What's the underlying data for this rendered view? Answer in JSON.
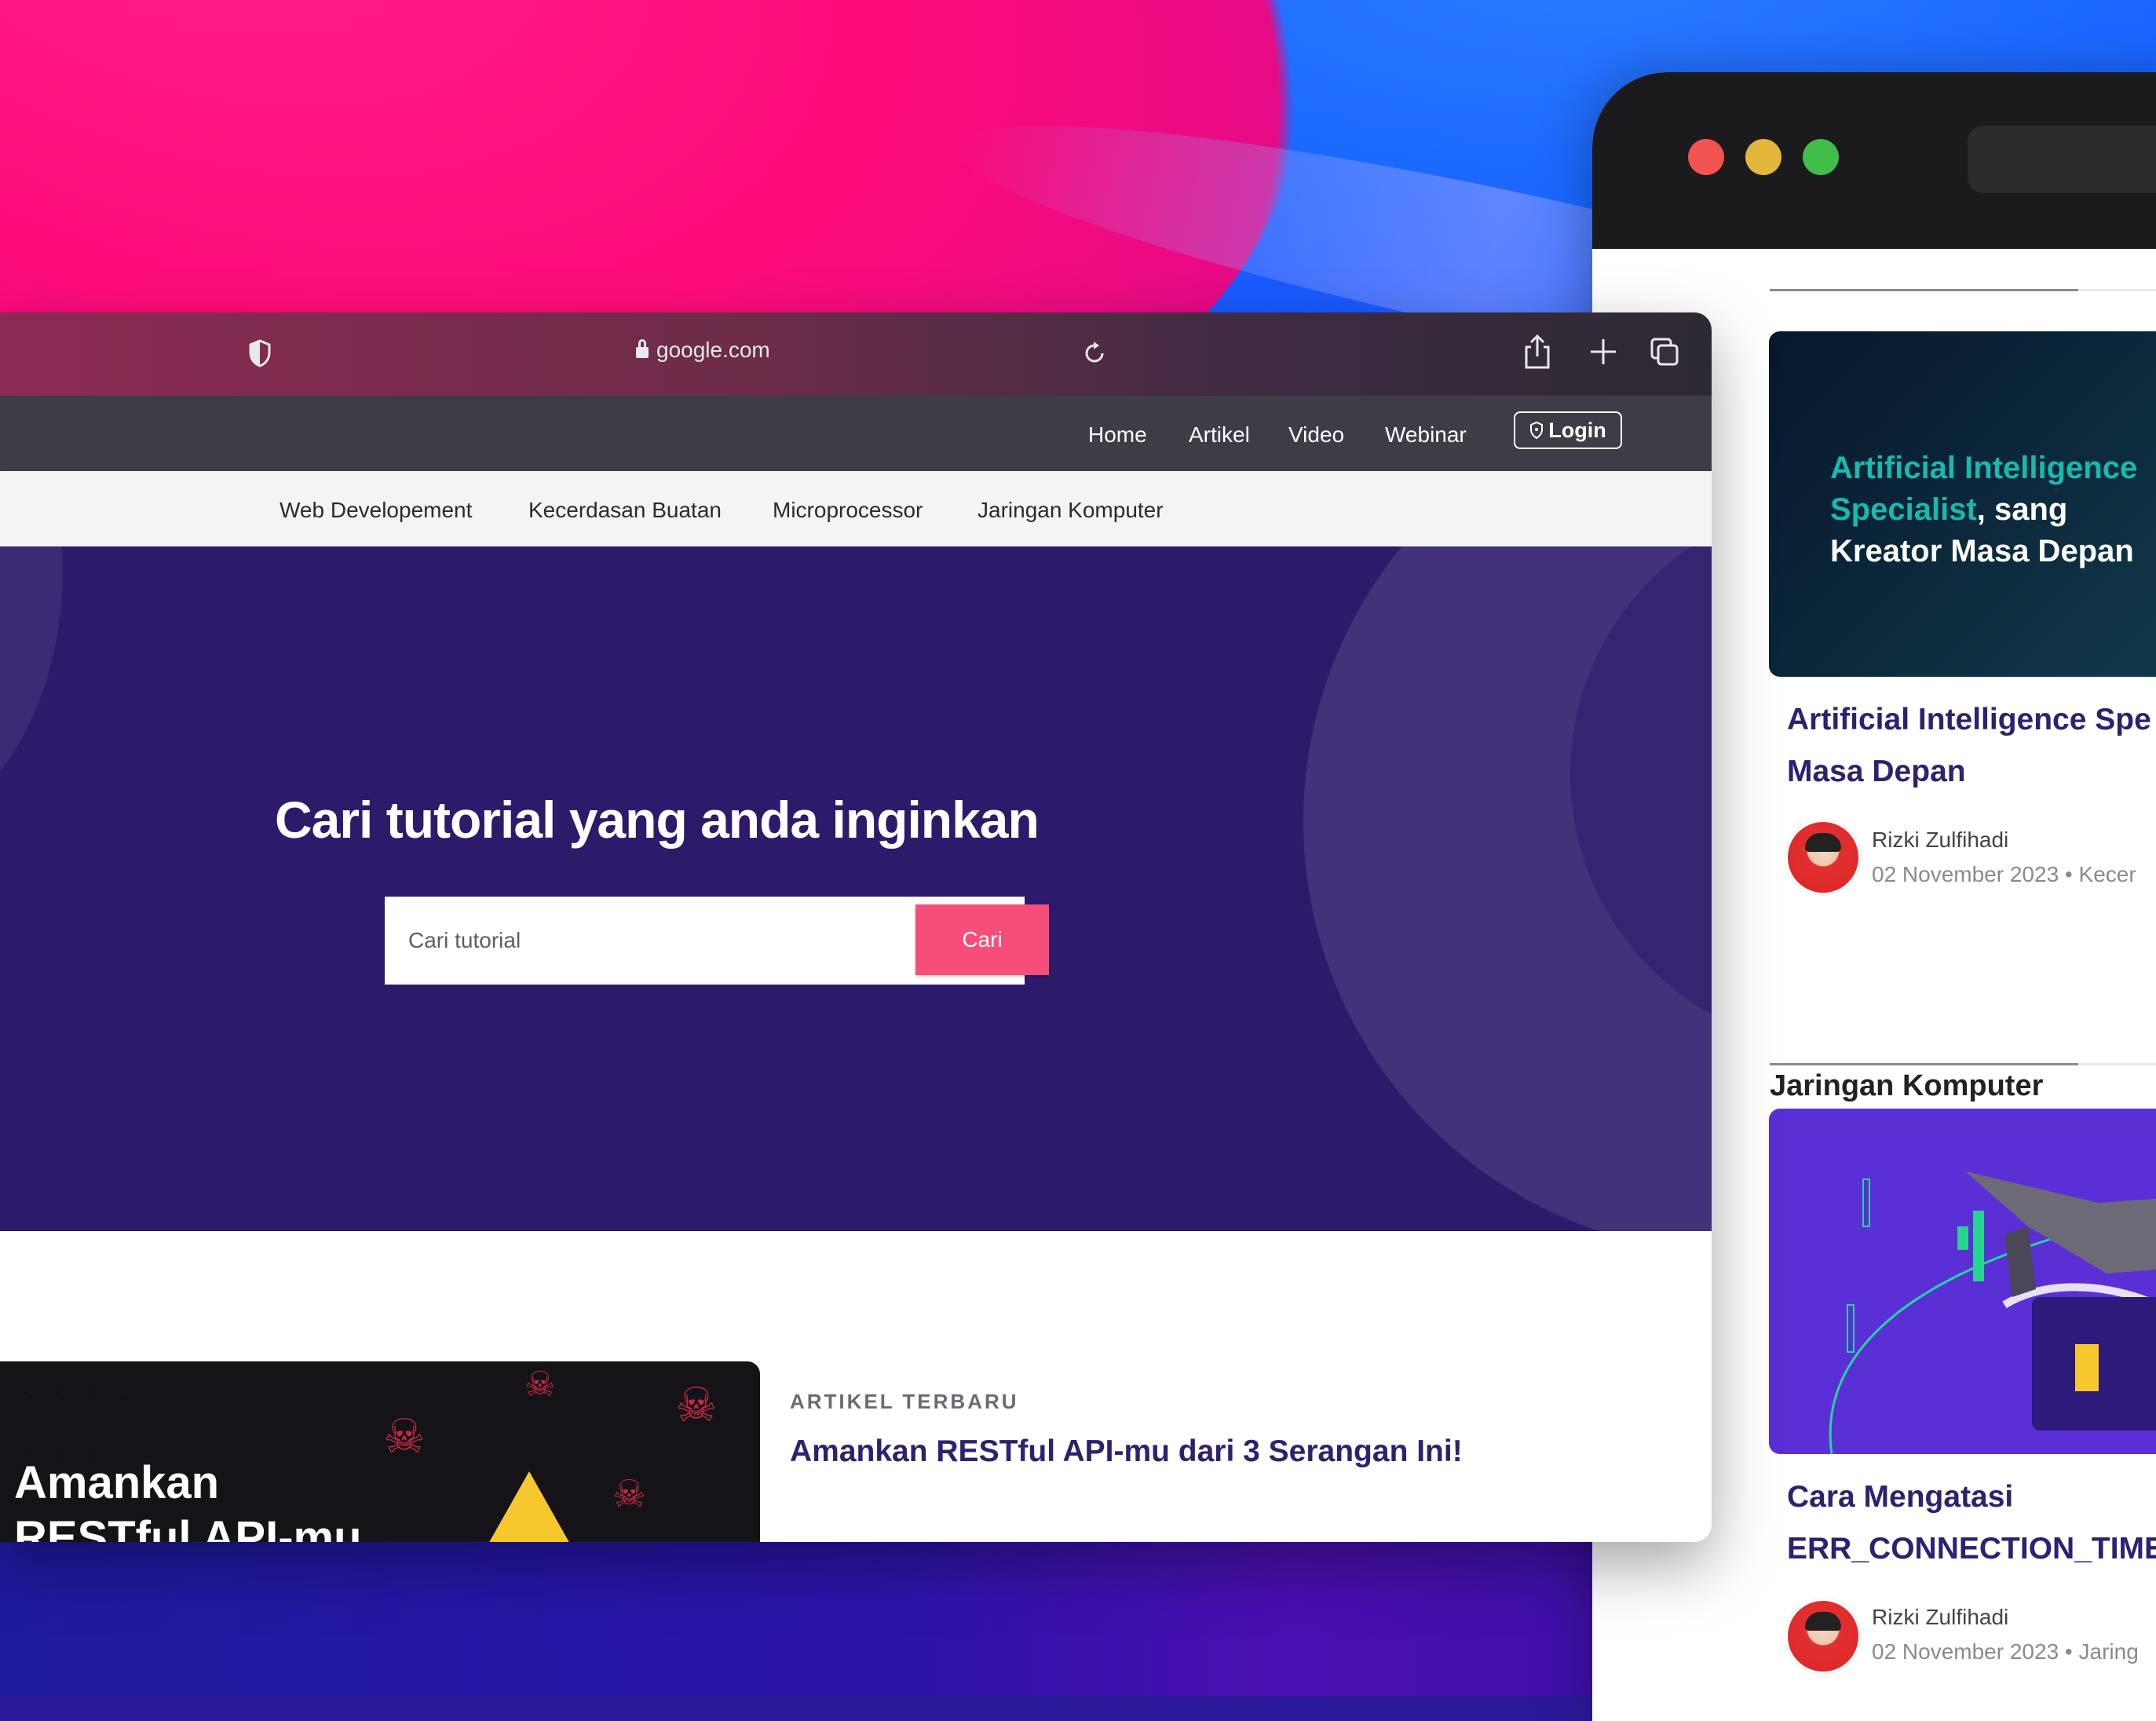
{
  "browser": {
    "url": "google.com"
  },
  "nav": {
    "items": [
      "Home",
      "Artikel",
      "Video",
      "Webinar"
    ],
    "login_label": "Login"
  },
  "categories": [
    "Web Developement",
    "Kecerdasan Buatan",
    "Microprocessor",
    "Jaringan Komputer"
  ],
  "hero": {
    "title": "Cari tutorial yang anda inginkan",
    "search_placeholder": "Cari tutorial",
    "search_button": "Cari"
  },
  "latest": {
    "kicker": "ARTIKEL TERBARU",
    "title": "Amankan RESTful API-mu dari 3 Serangan Ini!",
    "image_text_line1": "Amankan",
    "image_text_line2": "RESTful API-mu"
  },
  "side": {
    "ai_card": {
      "image_accent": "Artificial Intelligence Specialist",
      "image_text_rest": ", sang Kreator Masa Depan",
      "title_line1": "Artificial Intelligence Spe",
      "title_line2": "Masa Depan",
      "author": "Rizki Zulfihadi",
      "meta": "02 November 2023 • Kecer"
    },
    "section_heading": "Jaringan Komputer",
    "net_card": {
      "title_line1": "Cara Mengatasi",
      "title_line2": "ERR_CONNECTION_TIME",
      "author": "Rizki Zulfihadi",
      "meta": "02 November 2023 • Jaring"
    }
  },
  "colors": {
    "hero_bg": "#2e1a6a",
    "accent_pink": "#f64d7a",
    "title_navy": "#2f216f",
    "navbar": "#3d3d48"
  },
  "icons": [
    "shield-icon",
    "lock-icon",
    "reload-icon",
    "share-icon",
    "plus-icon",
    "tabs-icon",
    "login-shield-icon"
  ]
}
